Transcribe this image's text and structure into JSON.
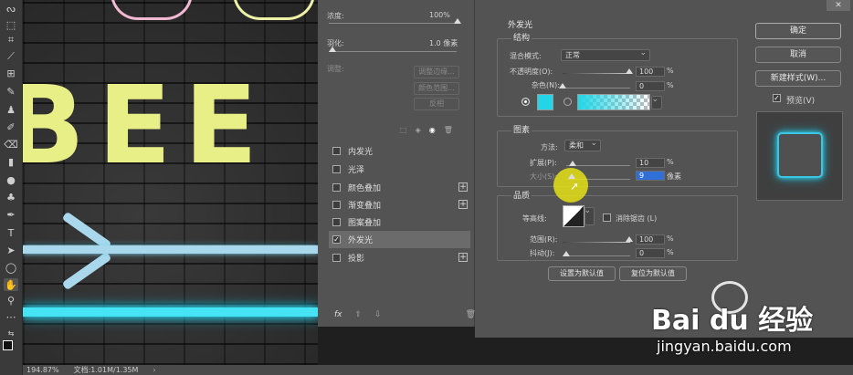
{
  "toolbar": {
    "icons": [
      "lasso-icon",
      "crop-icon",
      "eyedropper-icon",
      "frame-icon",
      "brush-icon",
      "stamp-icon",
      "history-brush-icon",
      "eraser-icon",
      "gradient-icon",
      "blur-icon",
      "dodge-icon",
      "pen-icon",
      "type-icon",
      "path-select-icon",
      "shape-icon",
      "hand-icon",
      "zoom-icon",
      "more-icon",
      "swap-icon",
      "colors-icon"
    ]
  },
  "canvas": {
    "letters": "BEE"
  },
  "status": {
    "zoom": "194.87%",
    "doc": "文档:1.01M/1.35M"
  },
  "left_panel": {
    "opacity_label": "浓度:",
    "opacity_value": "100%",
    "feather_label": "羽化:",
    "feather_value": "1.0 像素",
    "refine_label": "调整:",
    "btn_select_edge": "调整边缘...",
    "btn_color_range": "颜色范围...",
    "btn_invert": "反相"
  },
  "styles": [
    {
      "label": "内发光",
      "checked": false,
      "plus": false
    },
    {
      "label": "光泽",
      "checked": false,
      "plus": false
    },
    {
      "label": "颜色叠加",
      "checked": false,
      "plus": true
    },
    {
      "label": "渐变叠加",
      "checked": false,
      "plus": true
    },
    {
      "label": "图案叠加",
      "checked": false,
      "plus": false
    },
    {
      "label": "外发光",
      "checked": true,
      "plus": false,
      "selected": true
    },
    {
      "label": "投影",
      "checked": false,
      "plus": true
    }
  ],
  "bottom_bar": {
    "fx": "fx"
  },
  "dialog": {
    "title": "外发光",
    "structure": {
      "title": "结构",
      "blend_label": "混合模式:",
      "blend_value": "正常",
      "opacity_label": "不透明度(O):",
      "opacity_value": "100",
      "opacity_unit": "%",
      "noise_label": "杂色(N):",
      "noise_value": "0",
      "noise_unit": "%",
      "glow_color": "#22d6e8"
    },
    "elements": {
      "title": "图素",
      "method_label": "方法:",
      "method_value": "柔和",
      "spread_label": "扩展(P):",
      "spread_value": "10",
      "spread_unit": "%",
      "size_label": "大小(S):",
      "size_value": "9",
      "size_unit": "像素"
    },
    "quality": {
      "title": "品质",
      "contour_label": "等高线:",
      "antialias_label": "消除锯齿 (L)",
      "range_label": "范围(R):",
      "range_value": "100",
      "range_unit": "%",
      "jitter_label": "抖动(J):",
      "jitter_value": "0",
      "jitter_unit": "%"
    },
    "btn_set_default": "设置为默认值",
    "btn_reset_default": "复位为默认值"
  },
  "side_buttons": {
    "ok": "确定",
    "cancel": "取消",
    "new_style": "新建样式(W)...",
    "preview": "预览(V)"
  },
  "watermark": {
    "brand": "Bai du 经验",
    "url": "jingyan.baidu.com"
  },
  "colors": {
    "accent_cyan": "#3ad6ec",
    "neon_yellow": "#e8ef86"
  }
}
